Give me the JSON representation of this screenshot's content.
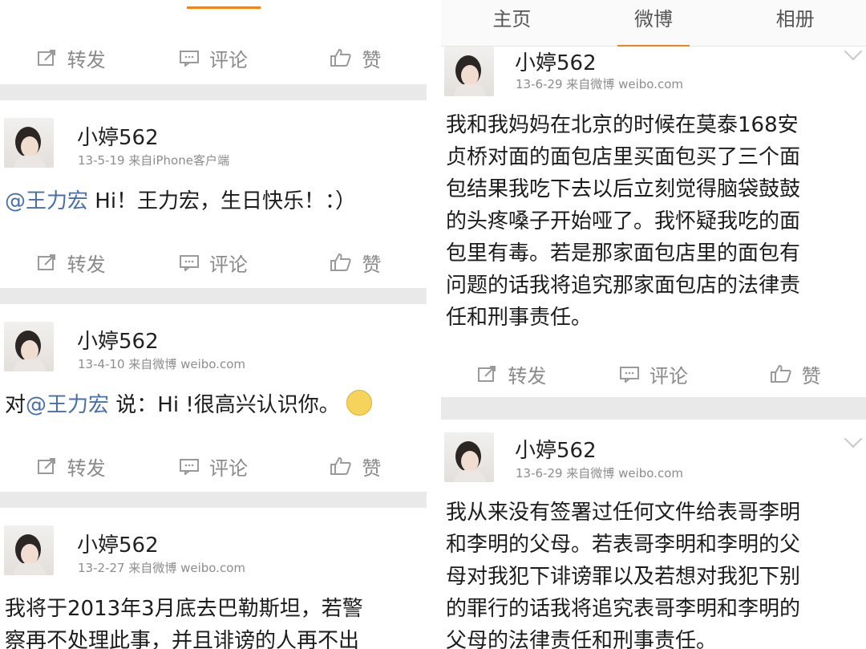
{
  "actions": {
    "repost": "转发",
    "comment": "评论",
    "like": "赞"
  },
  "tabs": {
    "home": "主页",
    "weibo": "微博",
    "album": "相册"
  },
  "left_posts": [
    {
      "user": "小婷562",
      "meta": "13-5-19 来自iPhone客户端",
      "mention": "@王力宏",
      "text": " Hi！王力宏，生日快乐！：）"
    },
    {
      "user": "小婷562",
      "meta": "13-4-10 来自微博 weibo.com",
      "prefix": "对",
      "mention": "@王力宏",
      "text": " 说：Hi !很高兴认识你。"
    },
    {
      "user": "小婷562",
      "meta": "13-2-27 来自微博 weibo.com",
      "line1": "我将于2013年3月底去巴勒斯坦，若警",
      "line2": "察再不处理此事，并且诽谤的人再不出"
    }
  ],
  "right_posts": [
    {
      "user": "小婷562",
      "meta": "13-6-29 来自微博 weibo.com",
      "lines": [
        "我和我妈妈在北京的时候在莫泰168安",
        "贞桥对面的面包店里买面包买了三个面",
        "包结果我吃下去以后立刻觉得脑袋鼓鼓",
        "的头疼嗓子开始哑了。我怀疑我吃的面",
        "包里有毒。若是那家面包店里的面包有",
        "问题的话我将追究那家面包店的法律责",
        "任和刑事责任。"
      ]
    },
    {
      "user": "小婷562",
      "meta": "13-6-29 来自微博 weibo.com",
      "lines": [
        "我从来没有签署过任何文件给表哥李明",
        "和李明的父母。若表哥李明和李明的父",
        "母对我犯下诽谤罪以及若想对我犯下别",
        "的罪行的话我将追究表哥李明和李明的",
        "父母的法律责任和刑事责任。"
      ]
    }
  ]
}
